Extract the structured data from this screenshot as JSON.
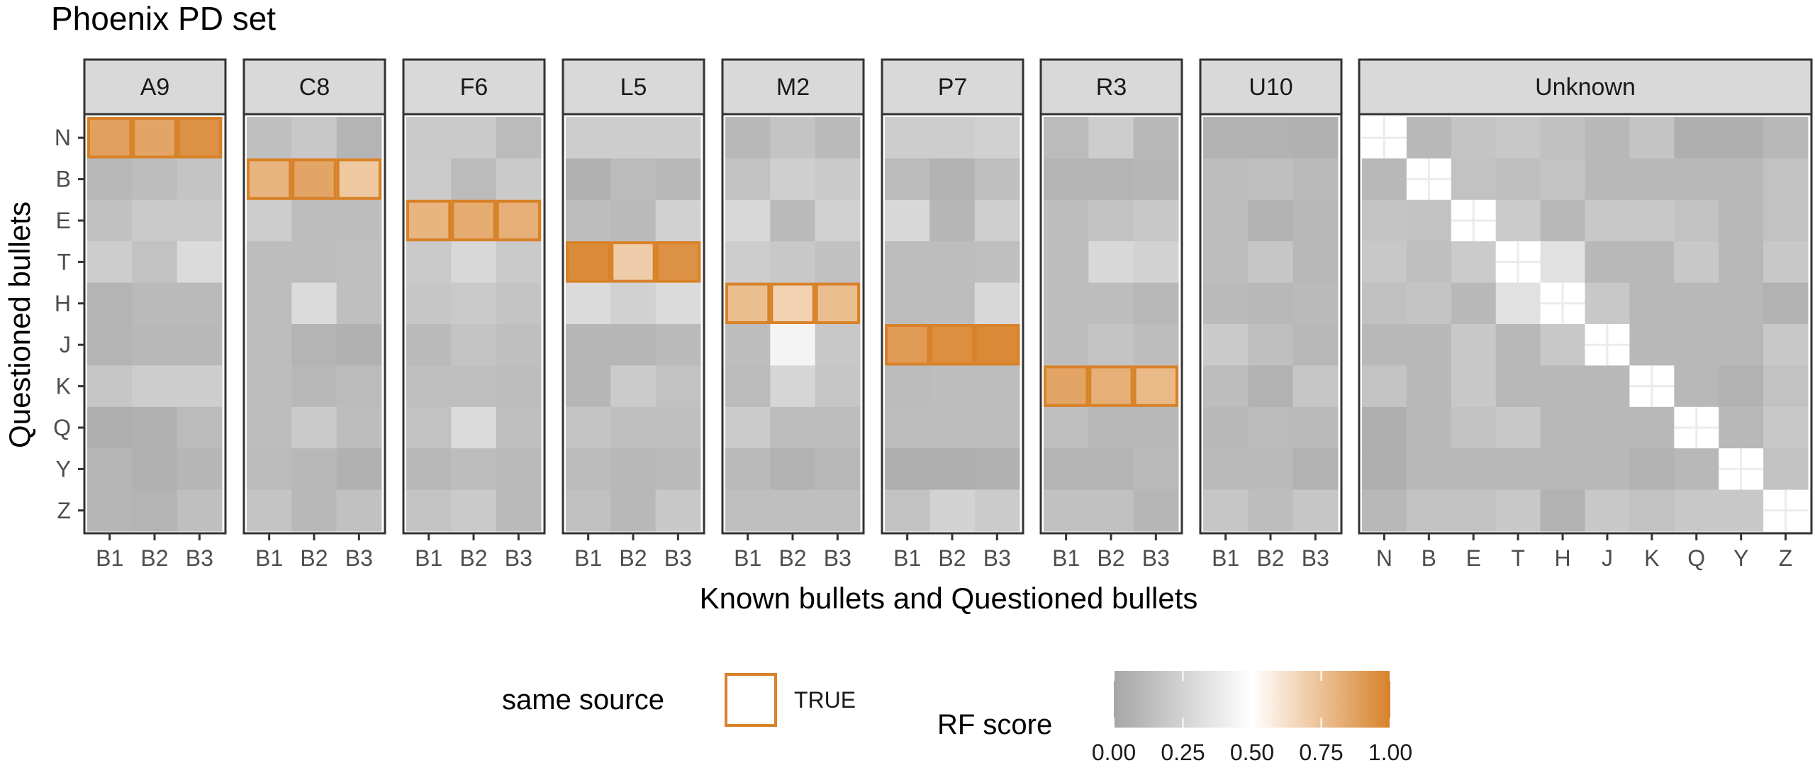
{
  "chart_data": {
    "type": "heatmap",
    "title": "Phoenix PD set",
    "xlabel": "Known bullets and Questioned bullets",
    "ylabel": "Questioned bullets",
    "y_categories": [
      "N",
      "B",
      "E",
      "T",
      "H",
      "J",
      "K",
      "Q",
      "Y",
      "Z"
    ],
    "color_scale": {
      "name": "RF score",
      "range": [
        0,
        1
      ],
      "ticks": [
        "0.00",
        "0.25",
        "0.50",
        "0.75",
        "1.00"
      ],
      "low_color": "#a6a6a6",
      "mid_color": "#ffffff",
      "high_color": "#d8822a",
      "midpoint": 0.5
    },
    "outline_legend": {
      "title": "same source",
      "label": "TRUE",
      "color": "#d8822a"
    },
    "panels": [
      {
        "name": "A9",
        "x_categories": [
          "B1",
          "B2",
          "B3"
        ],
        "same_source_row": "N",
        "values": [
          [
            0.88,
            0.86,
            0.94
          ],
          [
            0.1,
            0.13,
            0.17
          ],
          [
            0.15,
            0.2,
            0.2
          ],
          [
            0.22,
            0.16,
            0.3
          ],
          [
            0.08,
            0.11,
            0.11
          ],
          [
            0.08,
            0.1,
            0.1
          ],
          [
            0.18,
            0.22,
            0.22
          ],
          [
            0.05,
            0.06,
            0.12
          ],
          [
            0.09,
            0.06,
            0.09
          ],
          [
            0.09,
            0.08,
            0.14
          ]
        ]
      },
      {
        "name": "C8",
        "x_categories": [
          "B1",
          "B2",
          "B3"
        ],
        "same_source_row": "B",
        "values": [
          [
            0.14,
            0.19,
            0.08
          ],
          [
            0.8,
            0.86,
            0.72
          ],
          [
            0.22,
            0.13,
            0.13
          ],
          [
            0.13,
            0.13,
            0.14
          ],
          [
            0.13,
            0.3,
            0.14
          ],
          [
            0.13,
            0.08,
            0.06
          ],
          [
            0.13,
            0.1,
            0.12
          ],
          [
            0.13,
            0.2,
            0.13
          ],
          [
            0.12,
            0.1,
            0.06
          ],
          [
            0.17,
            0.1,
            0.15
          ]
        ]
      },
      {
        "name": "F6",
        "x_categories": [
          "B1",
          "B2",
          "B3"
        ],
        "same_source_row": "E",
        "values": [
          [
            0.2,
            0.2,
            0.12
          ],
          [
            0.21,
            0.12,
            0.2
          ],
          [
            0.8,
            0.83,
            0.82
          ],
          [
            0.2,
            0.28,
            0.2
          ],
          [
            0.18,
            0.2,
            0.17
          ],
          [
            0.11,
            0.17,
            0.14
          ],
          [
            0.14,
            0.14,
            0.13
          ],
          [
            0.16,
            0.3,
            0.14
          ],
          [
            0.1,
            0.13,
            0.11
          ],
          [
            0.17,
            0.2,
            0.11
          ]
        ]
      },
      {
        "name": "L5",
        "x_categories": [
          "B1",
          "B2",
          "B3"
        ],
        "same_source_row": "T",
        "values": [
          [
            0.22,
            0.22,
            0.22
          ],
          [
            0.06,
            0.12,
            0.1
          ],
          [
            0.13,
            0.11,
            0.24
          ],
          [
            0.96,
            0.7,
            0.94
          ],
          [
            0.3,
            0.24,
            0.3
          ],
          [
            0.09,
            0.09,
            0.11
          ],
          [
            0.09,
            0.21,
            0.16
          ],
          [
            0.17,
            0.14,
            0.14
          ],
          [
            0.12,
            0.1,
            0.11
          ],
          [
            0.15,
            0.1,
            0.19
          ]
        ]
      },
      {
        "name": "M2",
        "x_categories": [
          "B1",
          "B2",
          "B3"
        ],
        "same_source_row": "H",
        "values": [
          [
            0.1,
            0.17,
            0.11
          ],
          [
            0.16,
            0.23,
            0.2
          ],
          [
            0.28,
            0.11,
            0.24
          ],
          [
            0.22,
            0.19,
            0.15
          ],
          [
            0.76,
            0.68,
            0.76
          ],
          [
            0.13,
            0.44,
            0.19
          ],
          [
            0.12,
            0.27,
            0.18
          ],
          [
            0.21,
            0.13,
            0.13
          ],
          [
            0.11,
            0.07,
            0.1
          ],
          [
            0.14,
            0.14,
            0.14
          ]
        ]
      },
      {
        "name": "P7",
        "x_categories": [
          "B1",
          "B2",
          "B3"
        ],
        "same_source_row": "J",
        "values": [
          [
            0.22,
            0.22,
            0.24
          ],
          [
            0.12,
            0.07,
            0.14
          ],
          [
            0.28,
            0.09,
            0.23
          ],
          [
            0.13,
            0.13,
            0.14
          ],
          [
            0.13,
            0.13,
            0.28
          ],
          [
            0.9,
            0.95,
            0.97
          ],
          [
            0.12,
            0.13,
            0.13
          ],
          [
            0.13,
            0.13,
            0.13
          ],
          [
            0.05,
            0.05,
            0.06
          ],
          [
            0.16,
            0.25,
            0.21
          ]
        ]
      },
      {
        "name": "R3",
        "x_categories": [
          "B1",
          "B2",
          "B3"
        ],
        "same_source_row": "K",
        "values": [
          [
            0.12,
            0.22,
            0.1
          ],
          [
            0.08,
            0.08,
            0.09
          ],
          [
            0.13,
            0.16,
            0.19
          ],
          [
            0.13,
            0.28,
            0.25
          ],
          [
            0.13,
            0.13,
            0.1
          ],
          [
            0.13,
            0.17,
            0.13
          ],
          [
            0.86,
            0.82,
            0.78
          ],
          [
            0.14,
            0.1,
            0.1
          ],
          [
            0.08,
            0.08,
            0.11
          ],
          [
            0.15,
            0.15,
            0.09
          ]
        ]
      },
      {
        "name": "U10",
        "x_categories": [
          "B1",
          "B2",
          "B3"
        ],
        "same_source_row": null,
        "values": [
          [
            0.07,
            0.07,
            0.06
          ],
          [
            0.13,
            0.14,
            0.11
          ],
          [
            0.13,
            0.07,
            0.1
          ],
          [
            0.13,
            0.18,
            0.1
          ],
          [
            0.11,
            0.1,
            0.11
          ],
          [
            0.2,
            0.14,
            0.1
          ],
          [
            0.13,
            0.07,
            0.18
          ],
          [
            0.1,
            0.12,
            0.11
          ],
          [
            0.11,
            0.11,
            0.07
          ],
          [
            0.18,
            0.13,
            0.18
          ]
        ]
      },
      {
        "name": "Unknown",
        "x_categories": [
          "N",
          "B",
          "E",
          "T",
          "H",
          "J",
          "K",
          "Q",
          "Y",
          "Z"
        ],
        "same_source_row": null,
        "diagonal_missing": true,
        "values": [
          [
            null,
            0.1,
            0.17,
            0.19,
            0.15,
            0.1,
            0.17,
            0.05,
            0.05,
            0.1
          ],
          [
            0.1,
            null,
            0.16,
            0.14,
            0.17,
            0.1,
            0.1,
            0.1,
            0.1,
            0.16
          ],
          [
            0.17,
            0.16,
            null,
            0.21,
            0.1,
            0.19,
            0.19,
            0.16,
            0.1,
            0.16
          ],
          [
            0.19,
            0.14,
            0.21,
            null,
            0.33,
            0.1,
            0.1,
            0.19,
            0.1,
            0.19
          ],
          [
            0.15,
            0.17,
            0.1,
            0.33,
            null,
            0.19,
            0.1,
            0.1,
            0.1,
            0.07
          ],
          [
            0.1,
            0.1,
            0.19,
            0.1,
            0.19,
            null,
            0.1,
            0.1,
            0.1,
            0.19
          ],
          [
            0.17,
            0.1,
            0.19,
            0.1,
            0.1,
            0.1,
            null,
            0.1,
            0.07,
            0.16
          ],
          [
            0.05,
            0.1,
            0.16,
            0.19,
            0.1,
            0.1,
            0.1,
            null,
            0.1,
            0.19
          ],
          [
            0.05,
            0.1,
            0.1,
            0.1,
            0.1,
            0.1,
            0.07,
            0.1,
            null,
            0.16
          ],
          [
            0.1,
            0.16,
            0.16,
            0.19,
            0.07,
            0.19,
            0.16,
            0.19,
            0.19,
            null
          ]
        ]
      }
    ]
  }
}
